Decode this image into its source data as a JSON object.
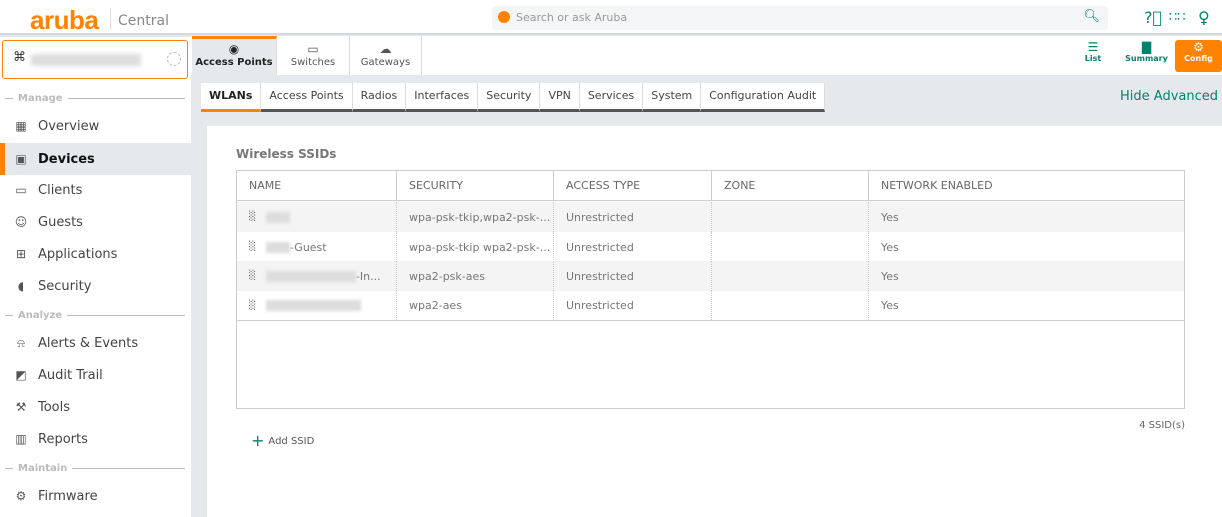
{
  "header": {
    "logo": "aruba",
    "product": "Central",
    "search_placeholder": "Search or ask Aruba"
  },
  "sidebar": {
    "sections": [
      {
        "label": "Manage"
      },
      {
        "label": "Analyze"
      },
      {
        "label": "Maintain"
      }
    ],
    "items": [
      {
        "label": "Overview",
        "icon": "grid-icon"
      },
      {
        "label": "Devices",
        "icon": "devices-icon"
      },
      {
        "label": "Clients",
        "icon": "clients-icon"
      },
      {
        "label": "Guests",
        "icon": "guests-icon"
      },
      {
        "label": "Applications",
        "icon": "applications-icon"
      },
      {
        "label": "Security",
        "icon": "shield-icon"
      },
      {
        "label": "Alerts & Events",
        "icon": "bell-icon"
      },
      {
        "label": "Audit Trail",
        "icon": "audit-icon"
      },
      {
        "label": "Tools",
        "icon": "wrench-icon"
      },
      {
        "label": "Reports",
        "icon": "report-icon"
      },
      {
        "label": "Firmware",
        "icon": "chip-icon"
      }
    ]
  },
  "device_tabs": [
    {
      "label": "Access Points"
    },
    {
      "label": "Switches"
    },
    {
      "label": "Gateways"
    }
  ],
  "views": [
    {
      "label": "List"
    },
    {
      "label": "Summary"
    },
    {
      "label": "Config"
    }
  ],
  "subtabs": [
    "WLANs",
    "Access Points",
    "Radios",
    "Interfaces",
    "Security",
    "VPN",
    "Services",
    "System",
    "Configuration Audit"
  ],
  "hide_advanced": "Hide Advanced",
  "card": {
    "title": "Wireless SSIDs",
    "columns": [
      "NAME",
      "SECURITY",
      "ACCESS TYPE",
      "ZONE",
      "NETWORK ENABLED"
    ],
    "rows": [
      {
        "name": "",
        "security": "wpa-psk-tkip,wpa2-psk-...",
        "access": "Unrestricted",
        "zone": "",
        "enabled": "Yes"
      },
      {
        "name": "-Guest",
        "security": "wpa-psk-tkip wpa2-psk-...",
        "access": "Unrestricted",
        "zone": "",
        "enabled": "Yes"
      },
      {
        "name": "-In...",
        "security": "wpa2-psk-aes",
        "access": "Unrestricted",
        "zone": "",
        "enabled": "Yes"
      },
      {
        "name": "",
        "security": "wpa2-aes",
        "access": "Unrestricted",
        "zone": "",
        "enabled": "Yes"
      }
    ],
    "count": "4 SSID(s)",
    "add_label": "Add SSID"
  }
}
